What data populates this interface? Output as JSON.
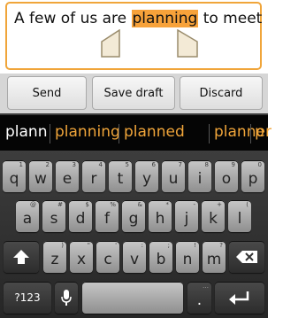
{
  "compose": {
    "text_before": "A few of us are ",
    "selected_word": "planning",
    "text_after": " to meet"
  },
  "actions": {
    "send": "Send",
    "save_draft": "Save draft",
    "discard": "Discard"
  },
  "suggestions": [
    "plann",
    "planning",
    "planned",
    "planner"
  ],
  "keyboard": {
    "row1": [
      {
        "k": "q",
        "h": "1"
      },
      {
        "k": "w",
        "h": "2"
      },
      {
        "k": "e",
        "h": "3"
      },
      {
        "k": "r",
        "h": "4"
      },
      {
        "k": "t",
        "h": "5"
      },
      {
        "k": "y",
        "h": "6"
      },
      {
        "k": "u",
        "h": "7"
      },
      {
        "k": "i",
        "h": "8"
      },
      {
        "k": "o",
        "h": "9"
      },
      {
        "k": "p",
        "h": "0"
      }
    ],
    "row2": [
      {
        "k": "a",
        "h": "@"
      },
      {
        "k": "s",
        "h": "#"
      },
      {
        "k": "d",
        "h": "$"
      },
      {
        "k": "f",
        "h": "%"
      },
      {
        "k": "g",
        "h": "&"
      },
      {
        "k": "h",
        "h": "*"
      },
      {
        "k": "j",
        "h": "-"
      },
      {
        "k": "k",
        "h": "+"
      },
      {
        "k": "l",
        "h": "("
      }
    ],
    "row3": [
      {
        "k": "z",
        "h": ")"
      },
      {
        "k": "x",
        "h": "\""
      },
      {
        "k": "c",
        "h": "'"
      },
      {
        "k": "v",
        "h": ":"
      },
      {
        "k": "b",
        "h": ";"
      },
      {
        "k": "n",
        "h": "!"
      },
      {
        "k": "m",
        "h": "?"
      }
    ],
    "symbols_label": "?123",
    "period_label": ".",
    "period_hint": "…"
  },
  "colors": {
    "accent_orange": "#f0a53a",
    "suggestion_text": "#f0a53a",
    "typed_text": "#ffffff"
  }
}
